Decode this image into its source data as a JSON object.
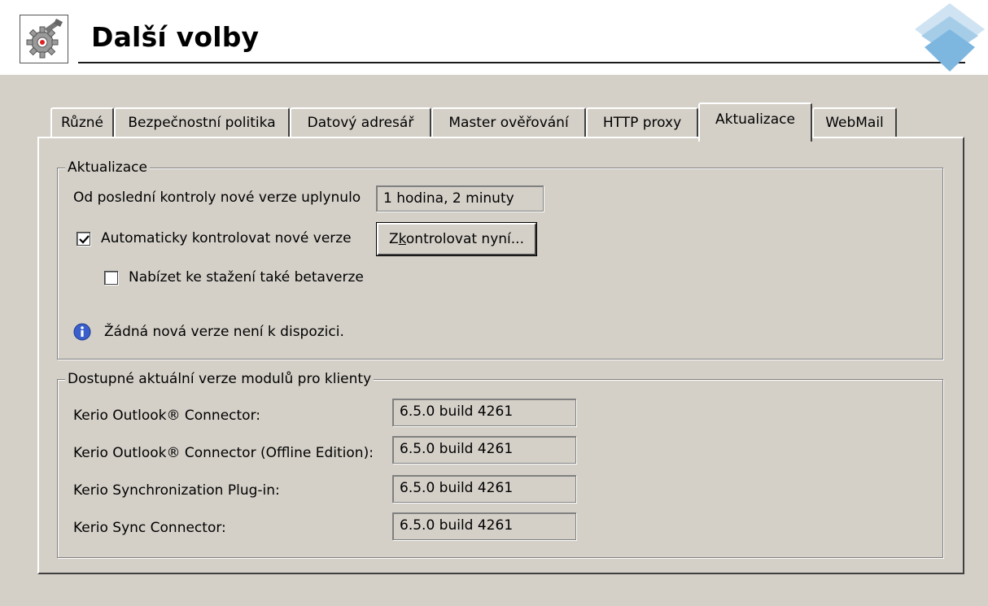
{
  "header": {
    "title": "Další volby",
    "icon": "settings-gear-wrench-icon",
    "logo": "kerio-logo-icon"
  },
  "tabs": [
    {
      "label": "Různé",
      "active": false
    },
    {
      "label": "Bezpečnostní politika",
      "active": false
    },
    {
      "label": "Datový adresář",
      "active": false
    },
    {
      "label": "Master ověřování",
      "active": false
    },
    {
      "label": "HTTP proxy",
      "active": false
    },
    {
      "label": "Aktualizace",
      "active": true
    },
    {
      "label": "WebMail",
      "active": false
    }
  ],
  "updates": {
    "group_title": "Aktualizace",
    "last_check_label": "Od poslední kontroly nové verze uplynulo",
    "last_check_value": "1 hodina, 2 minuty",
    "auto_check_label": "Automaticky kontrolovat nové verze",
    "auto_check_checked": true,
    "check_now_button_pre": "Z",
    "check_now_button_accel": "k",
    "check_now_button_post": "ontrolovat nyní...",
    "beta_label": "Nabízet ke stažení také betaverze",
    "beta_checked": false,
    "status_icon": "info-icon",
    "status_text": "Žádná nová verze není k dispozici."
  },
  "modules": {
    "group_title": "Dostupné aktuální verze modulů pro klienty",
    "rows": [
      {
        "label": "Kerio Outlook® Connector:",
        "value": "6.5.0 build 4261"
      },
      {
        "label": "Kerio Outlook® Connector (Offline Edition):",
        "value": "6.5.0 build 4261"
      },
      {
        "label": "Kerio Synchronization Plug-in:",
        "value": "6.5.0 build 4261"
      },
      {
        "label": "Kerio Sync Connector:",
        "value": "6.5.0 build 4261"
      }
    ]
  },
  "colors": {
    "dialog_bg": "#d4d0c8",
    "info_icon": "#3a5fcd"
  }
}
